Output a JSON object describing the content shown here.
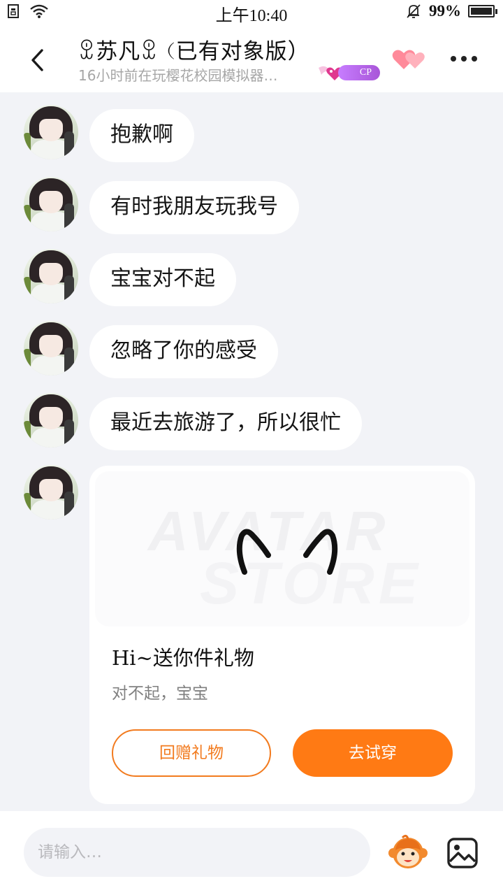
{
  "status_bar": {
    "time": "上午10:40",
    "battery": "99%",
    "battery_level": 0.99
  },
  "header": {
    "contact_name": "ꀾ苏凡ꀾ（已有对象版）",
    "status_text": "16小时前在玩樱花校园模拟器…",
    "badge_label": "CP"
  },
  "messages": [
    {
      "text": "抱歉啊"
    },
    {
      "text": "有时我朋友玩我号"
    },
    {
      "text": "宝宝对不起"
    },
    {
      "text": "忽略了你的感受"
    },
    {
      "text": "最近去旅游了，所以很忙"
    }
  ],
  "gift_card": {
    "watermark_line1": "AVATAR",
    "watermark_line2": "STORE",
    "title": "Hi~送你件礼物",
    "subtitle": "对不起，宝宝",
    "return_gift_label": "回赠礼物",
    "try_on_label": "去试穿"
  },
  "input_bar": {
    "placeholder": "请输入…"
  },
  "icons": {
    "back": "chevron-left-icon",
    "more": "more-dots-icon",
    "hearts": "hearts-icon",
    "sticker": "monkey-sticker-icon",
    "image": "image-icon"
  },
  "colors": {
    "accent": "#ff7a14",
    "badge": "#b462e0",
    "background": "#f2f3f7"
  }
}
